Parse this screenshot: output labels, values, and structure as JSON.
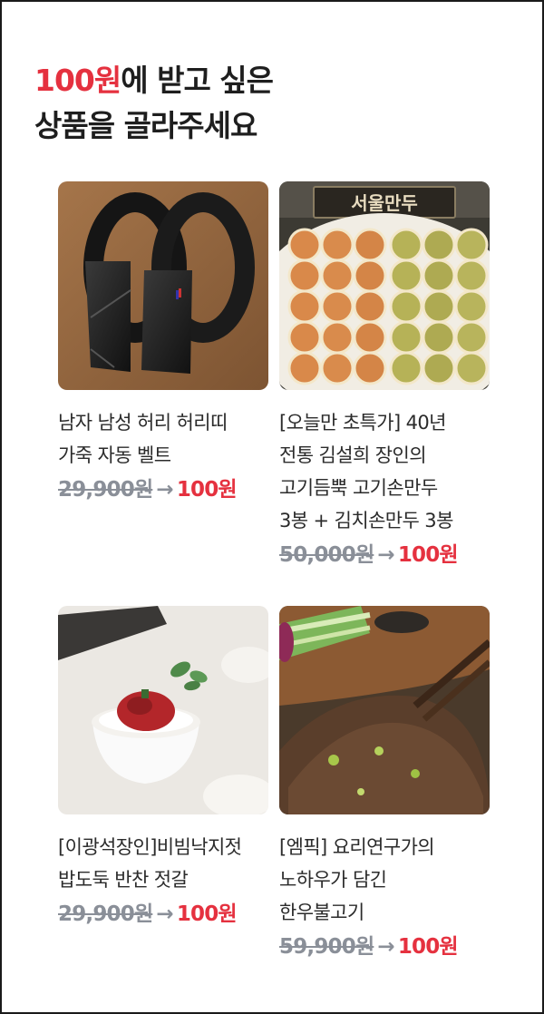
{
  "header": {
    "accent": "100원",
    "line1_rest": "에 받고 싶은",
    "line2": "상품을 골라주세요"
  },
  "products": [
    {
      "title_lines": [
        "남자 남성 허리 허리띠",
        "가죽 자동 벨트"
      ],
      "original_price": "29,900원",
      "arrow": "→",
      "sale_price": "100원",
      "image": "black-leather-belts-photo"
    },
    {
      "title_lines": [
        "[오늘만 초특가] 40년",
        "전통 김설희 장인의",
        "고기듬뿍 고기손만두",
        "3봉 + 김치손만두 3봉"
      ],
      "original_price": "50,000원",
      "arrow": "→",
      "sale_price": "100원",
      "image": "dumplings-photo",
      "image_sign_text": "서울만두"
    },
    {
      "title_lines": [
        "[이광석장인]비빔낙지젓",
        "밥도둑 반찬 젓갈"
      ],
      "original_price": "29,900원",
      "arrow": "→",
      "sale_price": "100원",
      "image": "octopus-jeotgal-rice-bowl-photo"
    },
    {
      "title_lines": [
        "[엠픽] 요리연구가의",
        "노하우가 담긴",
        "한우불고기"
      ],
      "original_price": "59,900원",
      "arrow": "→",
      "sale_price": "100원",
      "image": "bulgogi-chopsticks-photo"
    }
  ],
  "colors": {
    "accent": "#e5313f",
    "strikethrough_gray": "#8a8f98",
    "text": "#2b2b2b"
  }
}
